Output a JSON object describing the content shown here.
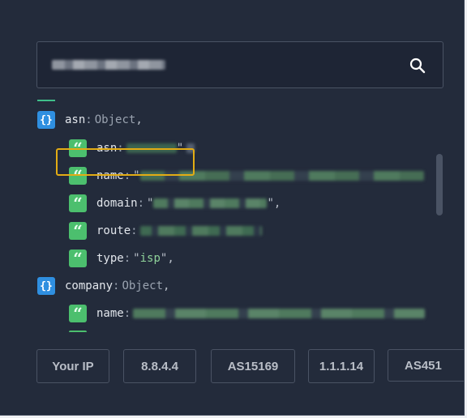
{
  "search": {
    "value": ""
  },
  "tree": {
    "asn_key": "asn",
    "asn_type": "Object",
    "asn_children": [
      {
        "key": "asn"
      },
      {
        "key": "name"
      },
      {
        "key": "domain"
      },
      {
        "key": "route"
      },
      {
        "key": "type",
        "value": "isp"
      }
    ],
    "company_key": "company",
    "company_type": "Object",
    "company_children": [
      {
        "key": "name"
      }
    ]
  },
  "buttons": [
    "Your IP",
    "8.8.4.4",
    "AS15169",
    "1.1.1.14",
    "AS451"
  ],
  "colors": {
    "object_badge": "#2f8fe0",
    "string_badge": "#4cbf6e",
    "highlight": "#e3ac14"
  }
}
